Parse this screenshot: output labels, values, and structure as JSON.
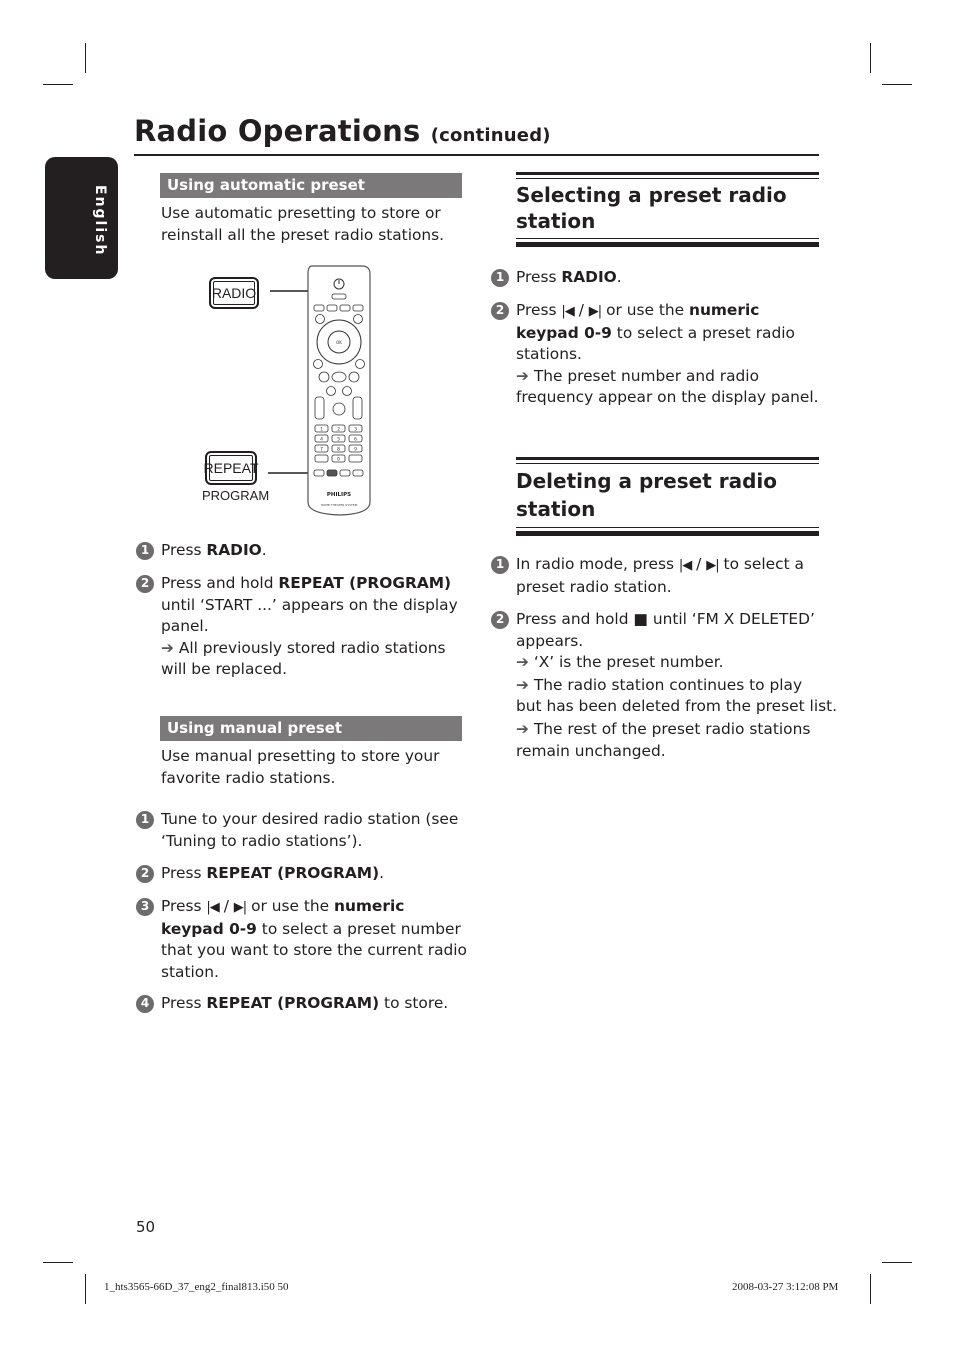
{
  "header": {
    "title": "Radio Operations",
    "title_suffix": "(continued)",
    "language_tab": "English"
  },
  "left": {
    "auto_preset": {
      "heading": "Using automatic preset",
      "intro_line1": "Use automatic presetting to store or",
      "intro_line2": "reinstall all the preset radio stations.",
      "illustration": {
        "radio_button_label": "RADIO",
        "repeat_button_label": "REPEAT",
        "program_label": "PROGRAM",
        "brand": "PHILIPS",
        "remote_caption": "HOME THEATER SYSTEM",
        "keypad": [
          "1",
          "2",
          "3",
          "4",
          "5",
          "6",
          "7",
          "8",
          "9",
          "",
          "0",
          ""
        ]
      },
      "steps": [
        {
          "num": "1",
          "pre": "Press ",
          "bold": "RADIO",
          "post": "."
        },
        {
          "num": "2",
          "pre": "Press and hold ",
          "bold": "REPEAT (PROGRAM)",
          "line2": "until ‘START ...’ appears on the display",
          "line3": "panel.",
          "note1": "All previously stored radio stations",
          "note2": "will be replaced."
        }
      ]
    },
    "manual_preset": {
      "heading": "Using manual preset",
      "intro_line1": "Use manual presetting to store your",
      "intro_line2": "favorite radio stations.",
      "steps": [
        {
          "num": "1",
          "line1": "Tune to your desired radio station (see",
          "line2": "‘Tuning to radio stations’)."
        },
        {
          "num": "2",
          "pre": "Press ",
          "bold": "REPEAT (PROGRAM)",
          "post": "."
        },
        {
          "num": "3",
          "pre": "Press ",
          "prev_icon": "⏮",
          "sep": " / ",
          "next_icon": "⏭",
          "mid": " or use the ",
          "bold": "numeric",
          "bold2": "keypad 0-9",
          "post": " to select a preset number",
          "line3": "that you want to store the current radio",
          "line4": "station."
        },
        {
          "num": "4",
          "pre": "Press ",
          "bold": "REPEAT (PROGRAM)",
          "post": " to store."
        }
      ]
    }
  },
  "right": {
    "selecting": {
      "heading_line1": "Selecting a preset radio",
      "heading_line2": "station",
      "steps": [
        {
          "num": "1",
          "pre": "Press ",
          "bold": "RADIO",
          "post": "."
        },
        {
          "num": "2",
          "pre": "Press ",
          "mid": " or use the ",
          "bold": "numeric",
          "bold2": "keypad 0-9",
          "post": " to select a preset radio",
          "line3": "stations.",
          "note1": "The preset number and radio",
          "note2": "frequency appear on the display panel."
        }
      ]
    },
    "deleting": {
      "heading_line1": "Deleting a preset radio",
      "heading_line2": "station",
      "steps": [
        {
          "num": "1",
          "pre": "In radio mode, press ",
          "post": " to select a",
          "line2": "preset radio station."
        },
        {
          "num": "2",
          "pre": "Press and hold ",
          "stop_icon": "■",
          "post": " until ‘FM X DELETED’",
          "line2": "appears.",
          "note1": "‘X’ is the preset number.",
          "note2a": "The radio station continues to play",
          "note2b": "but has been deleted from the preset list.",
          "note3a": "The rest of the preset radio stations",
          "note3b": "remain unchanged."
        }
      ]
    }
  },
  "icons": {
    "arrow": "➔",
    "prev": "|◀",
    "next": "▶|",
    "stop": "■"
  },
  "footer": {
    "page_number": "50",
    "file_name": "1_hts3565-66D_37_eng2_final813.i50   50",
    "timestamp": "2008-03-27   3:12:08 PM"
  }
}
